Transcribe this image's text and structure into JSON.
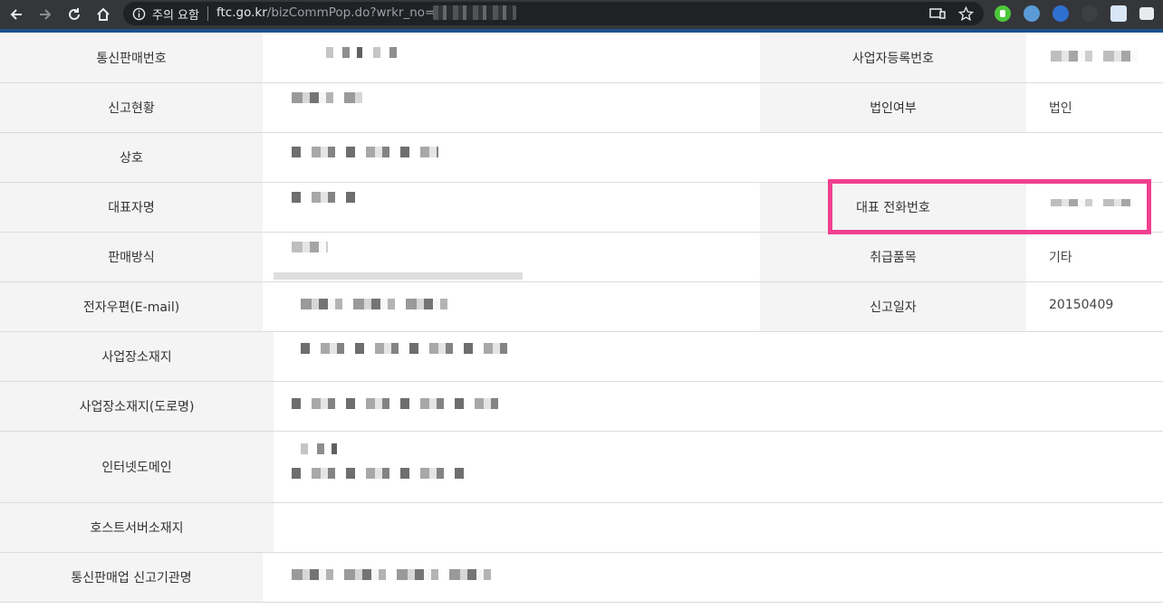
{
  "browser": {
    "security_label": "주의 요함",
    "url_host": "ftc.go.kr",
    "url_path": "/bizCommPop.do?wrkr_no=",
    "icons": [
      "back-icon",
      "forward-icon",
      "reload-icon",
      "home-icon",
      "info-icon",
      "cast-icon",
      "bookmark-star-icon"
    ]
  },
  "rows": [
    {
      "label": "통신판매번호",
      "right_label": "사업자등록번호",
      "right_value": ""
    },
    {
      "label": "신고현황",
      "right_label": "법인여부",
      "right_value": "법인"
    },
    {
      "label": "상호",
      "right_label": "",
      "right_value": ""
    },
    {
      "label": "대표자명",
      "right_label": "대표 전화번호",
      "right_value": ""
    },
    {
      "label": "판매방식",
      "right_label": "취급품목",
      "right_value": "기타"
    },
    {
      "label": "전자우편(E-mail)",
      "right_label": "신고일자",
      "right_value": "20150409"
    },
    {
      "label": "사업장소재지",
      "right_label": "",
      "right_value": ""
    },
    {
      "label": "사업장소재지(도로명)",
      "right_label": "",
      "right_value": ""
    },
    {
      "label": "인터넷도메인",
      "right_label": "",
      "right_value": ""
    },
    {
      "label": "호스트서버소재지",
      "right_label": "",
      "right_value": ""
    },
    {
      "label": "통신판매업 신고기관명",
      "right_label": "",
      "right_value": ""
    }
  ],
  "colors": {
    "toolbar": "#35363a",
    "omnibox": "#202124",
    "header_cell": "#f4f4f4",
    "highlight": "#f0408f",
    "accent_line": "#1c4f8c"
  }
}
